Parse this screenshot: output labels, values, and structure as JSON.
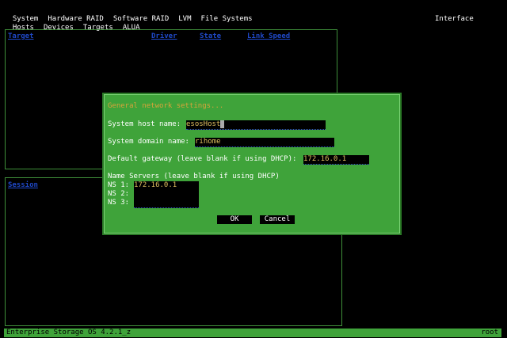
{
  "menu_row1": [
    "System",
    "Hardware RAID",
    "Software RAID",
    "LVM",
    "File Systems"
  ],
  "menu_row2": [
    "Hosts",
    "Devices",
    "Targets",
    "ALUA"
  ],
  "interface_label": "Interface",
  "target_panel": {
    "headers": [
      "Target",
      "Driver",
      "State",
      "Link Speed"
    ]
  },
  "session_panel": {
    "header": "Session"
  },
  "dialog": {
    "title": "General network settings...",
    "host_label": "System host name:",
    "host_value": "esosHost",
    "domain_label": "System domain name:",
    "domain_value": "rihome",
    "gateway_label": "Default gateway (leave blank if using DHCP):",
    "gateway_value": "172.16.0.1",
    "ns_heading": "Name Servers (leave blank if using DHCP)",
    "ns1_label": "NS 1:",
    "ns1_value": "172.16.0.1",
    "ns2_label": "NS 2:",
    "ns2_value": "",
    "ns3_label": "NS 3:",
    "ns3_value": "",
    "ok_label": "OK",
    "cancel_label": "Cancel"
  },
  "status_bar": {
    "left": "Enterprise Storage OS 4.2.1_z",
    "right": "root"
  },
  "colors": {
    "accent_green": "#3fa33a",
    "header_blue": "#1f49c9",
    "title_orange": "#d8a33a"
  }
}
